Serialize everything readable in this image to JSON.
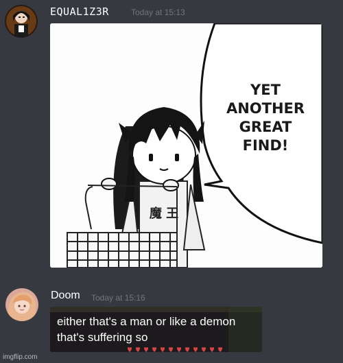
{
  "messages": [
    {
      "username": "EQUAL1Z3R",
      "timestamp": "Today at 15:13",
      "speech_bubble": [
        "YET",
        "ANOTHER",
        "GREAT",
        "FIND!"
      ],
      "shirt_text": "魔 王"
    },
    {
      "username": "Doom",
      "timestamp": "Today at 15:16",
      "caption_lines": [
        "either that's a man or like a demon",
        "that's suffering so"
      ]
    }
  ],
  "watermark": "imgflip.com",
  "colors": {
    "background": "#36393f",
    "username": "#ffffff",
    "timestamp": "#72767d",
    "caption_bg": "#1c1a1c",
    "heart": "#d64545"
  }
}
